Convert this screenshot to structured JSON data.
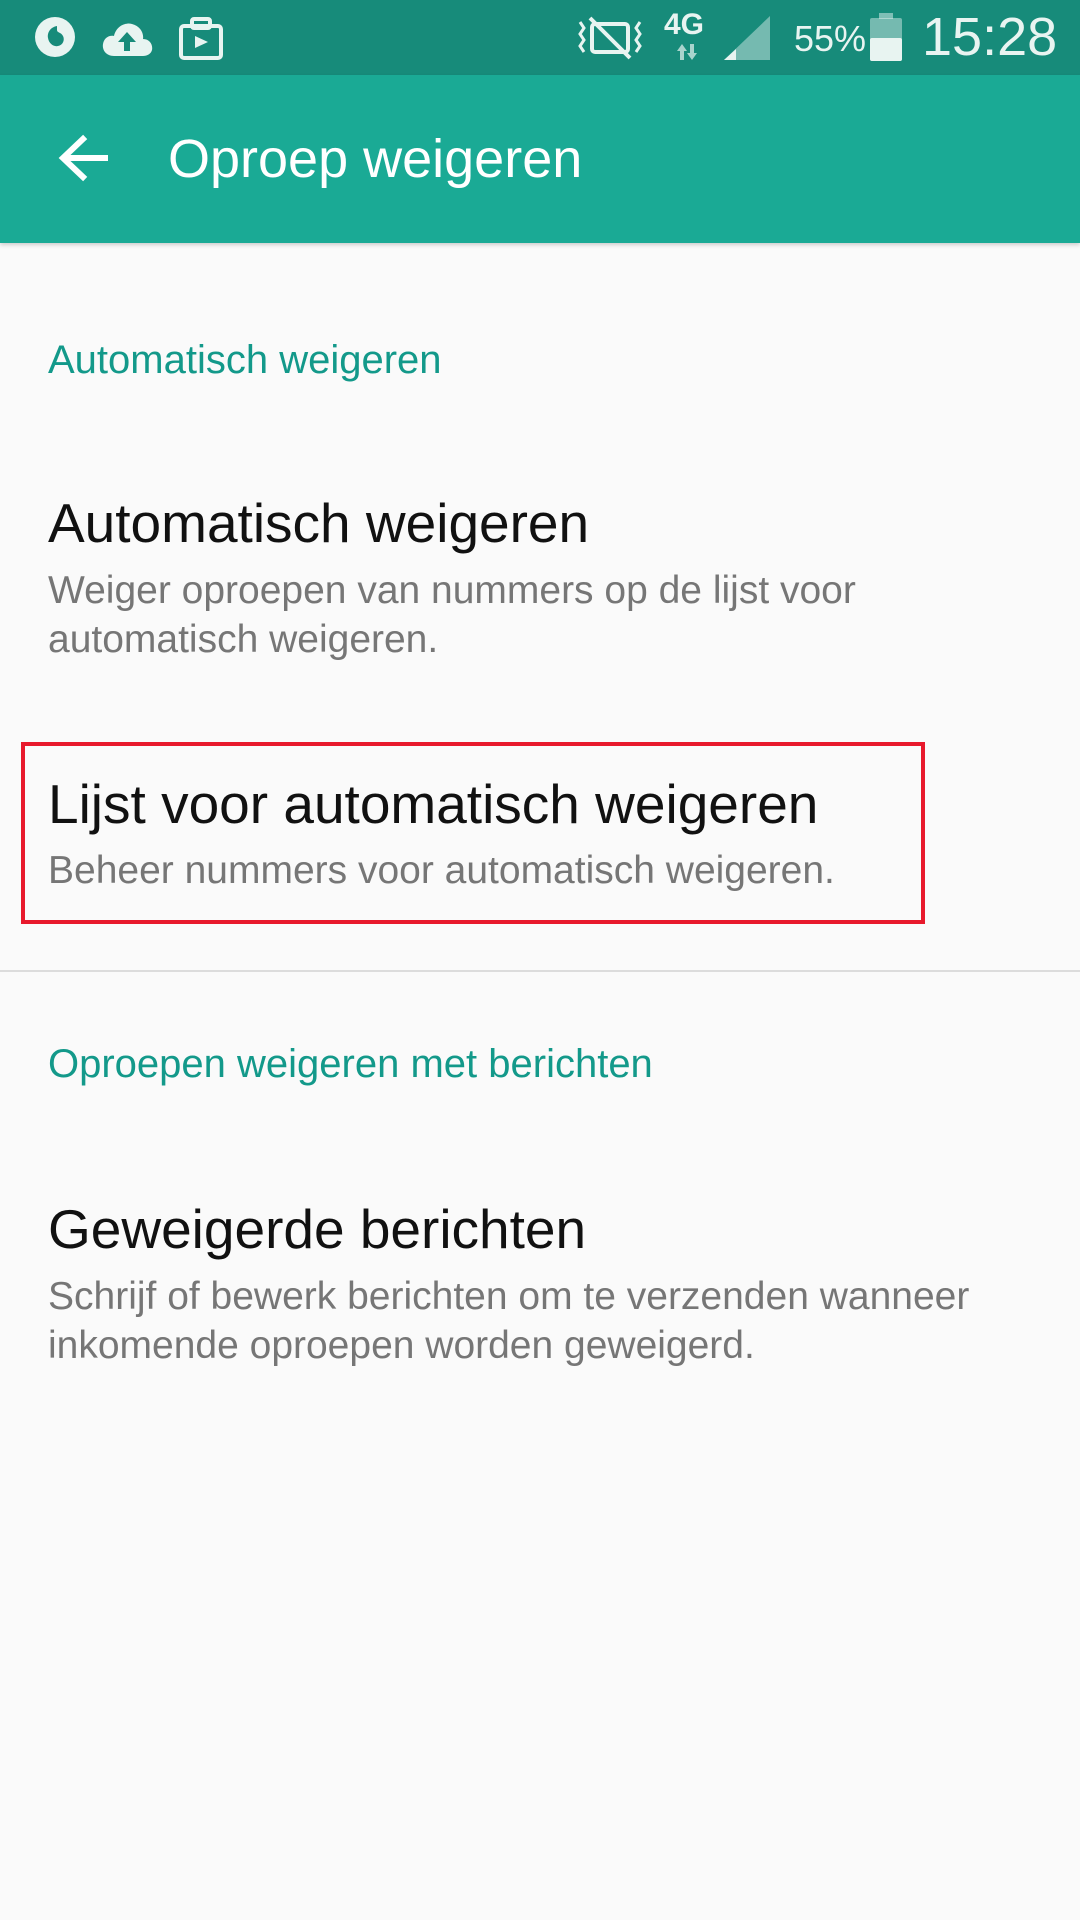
{
  "status_bar": {
    "battery_percent": "55%",
    "network_type": "4G",
    "time": "15:28",
    "icons": [
      "vodafone-icon",
      "cloud-upload-icon",
      "briefcase-icon",
      "vibrate-icon",
      "signal-icon",
      "battery-icon"
    ]
  },
  "app_bar": {
    "title": "Oproep weigeren",
    "back_icon": "arrow-back-icon"
  },
  "sections": [
    {
      "header": "Automatisch weigeren",
      "items": [
        {
          "title": "Automatisch weigeren",
          "summary": "Weiger oproepen van nummers op de lijst voor automatisch weigeren."
        },
        {
          "title": "Lijst voor automatisch weigeren",
          "summary": "Beheer nummers voor automatisch weigeren."
        }
      ]
    },
    {
      "header": "Oproepen weigeren met berichten",
      "items": [
        {
          "title": "Geweigerde berichten",
          "summary": "Schrijf of bewerk berichten om te verzenden wanneer inkomende oproepen worden geweigerd."
        }
      ]
    }
  ],
  "colors": {
    "status_bar": "#178b7a",
    "app_bar": "#1aaa95",
    "accent": "#13998a",
    "highlight": "#e8192c"
  }
}
